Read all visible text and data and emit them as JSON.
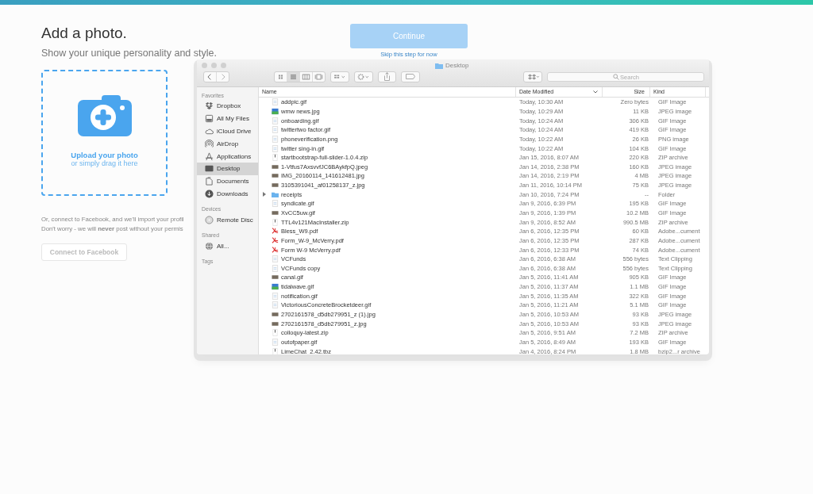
{
  "page": {
    "title": "Add a photo.",
    "subtitle": "Show your unique personality and style.",
    "continue_button": "Continue",
    "skip_link": "Skip this step for now",
    "upload": {
      "title": "Upload your photo",
      "hint": "or simply drag it here"
    },
    "facebook_text": "Or, connect to Facebook, and we'll import your profil\nDon't worry - we will **never** post without your permis",
    "facebook_button": "Connect to Facebook"
  },
  "finder": {
    "title": "Desktop",
    "search": {
      "placeholder": "Search"
    },
    "sidebar": [
      {
        "heading": "Favorites",
        "items": [
          {
            "label": "Dropbox",
            "kind": "dropbox",
            "selected": false
          },
          {
            "label": "All My Files",
            "kind": "files",
            "selected": false
          },
          {
            "label": "iCloud Drive",
            "kind": "cloud",
            "selected": false
          },
          {
            "label": "AirDrop",
            "kind": "airdrop",
            "selected": false
          },
          {
            "label": "Applications",
            "kind": "apps",
            "selected": false
          },
          {
            "label": "Desktop",
            "kind": "desktop",
            "selected": true
          },
          {
            "label": "Documents",
            "kind": "documents",
            "selected": false
          },
          {
            "label": "Downloads",
            "kind": "downloads",
            "selected": false
          }
        ]
      },
      {
        "heading": "Devices",
        "items": [
          {
            "label": "Remote Disc",
            "kind": "disc",
            "selected": false
          }
        ]
      },
      {
        "heading": "Shared",
        "items": [
          {
            "label": "All...",
            "kind": "globe",
            "selected": false
          }
        ]
      },
      {
        "heading": "Tags"
      }
    ],
    "columns": [
      "Name",
      "Date Modified",
      "Size",
      "Kind"
    ],
    "rows": [
      {
        "name": "addpic.gif",
        "date": "Today, 10:30 AM",
        "size": "Zero bytes",
        "kind_text": "GIF Image",
        "kind": "doc"
      },
      {
        "name": "wmw news.jpg",
        "date": "Today, 10:29 AM",
        "size": "11 KB",
        "kind_text": "JPEG image",
        "kind": "image"
      },
      {
        "name": "onboarding.gif",
        "date": "Today, 10:24 AM",
        "size": "306 KB",
        "kind_text": "GIF Image",
        "kind": "doc"
      },
      {
        "name": "twittertwo factor.gif",
        "date": "Today, 10:24 AM",
        "size": "419 KB",
        "kind_text": "GIF Image",
        "kind": "doc"
      },
      {
        "name": "phoneverification.png",
        "date": "Today, 10:22 AM",
        "size": "26 KB",
        "kind_text": "PNG image",
        "kind": "doc"
      },
      {
        "name": "twitter sing-in.gif",
        "date": "Today, 10:22 AM",
        "size": "104 KB",
        "kind_text": "GIF Image",
        "kind": "doc"
      },
      {
        "name": "startbootstrap-full-slider-1.0.4.zip",
        "date": "Jan 15, 2016, 8:07 AM",
        "size": "220 KB",
        "kind_text": "ZIP archive",
        "kind": "zip"
      },
      {
        "name": "1-Vtfus7AxsvvfJC6BAykfpQ.jpeg",
        "date": "Jan 14, 2016, 2:38 PM",
        "size": "160 KB",
        "kind_text": "JPEG image",
        "kind": "photo"
      },
      {
        "name": "IMG_20160114_141612481.jpg",
        "date": "Jan 14, 2016, 2:19 PM",
        "size": "4 MB",
        "kind_text": "JPEG image",
        "kind": "photo"
      },
      {
        "name": "3105391041_af01258137_z.jpg",
        "date": "Jan 11, 2016, 10:14 PM",
        "size": "75 KB",
        "kind_text": "JPEG image",
        "kind": "photo"
      },
      {
        "name": "receipts",
        "date": "Jan 10, 2016, 7:24 PM",
        "size": "--",
        "kind_text": "Folder",
        "kind": "folder",
        "expanded": false
      },
      {
        "name": "syndicate.gif",
        "date": "Jan 9, 2016, 6:39 PM",
        "size": "195 KB",
        "kind_text": "GIF Image",
        "kind": "doc"
      },
      {
        "name": "XvCC5uw.gif",
        "date": "Jan 9, 2016, 1:39 PM",
        "size": "10.2 MB",
        "kind_text": "GIF Image",
        "kind": "photo"
      },
      {
        "name": "TTL4v121MacInstaller.zip",
        "date": "Jan 9, 2016, 8:52 AM",
        "size": "990.5 MB",
        "kind_text": "ZIP archive",
        "kind": "zip"
      },
      {
        "name": "Bless_W9.pdf",
        "date": "Jan 6, 2016, 12:35 PM",
        "size": "60 KB",
        "kind_text": "Adobe...cument",
        "kind": "pdf"
      },
      {
        "name": "Form_W-9_McVerry.pdf",
        "date": "Jan 6, 2016, 12:35 PM",
        "size": "287 KB",
        "kind_text": "Adobe...cument",
        "kind": "pdf"
      },
      {
        "name": "Form W-9 McVerry.pdf",
        "date": "Jan 6, 2016, 12:33 PM",
        "size": "74 KB",
        "kind_text": "Adobe...cument",
        "kind": "pdf"
      },
      {
        "name": "VCFunds",
        "date": "Jan 6, 2016, 6:38 AM",
        "size": "556 bytes",
        "kind_text": "Text Clipping",
        "kind": "doc"
      },
      {
        "name": "VCFunds copy",
        "date": "Jan 6, 2016, 6:38 AM",
        "size": "556 bytes",
        "kind_text": "Text Clipping",
        "kind": "doc"
      },
      {
        "name": "canal.gif",
        "date": "Jan 5, 2016, 11:41 AM",
        "size": "905 KB",
        "kind_text": "GIF Image",
        "kind": "photo"
      },
      {
        "name": "tidalwave.gif",
        "date": "Jan 5, 2016, 11:37 AM",
        "size": "1.1 MB",
        "kind_text": "GIF Image",
        "kind": "image"
      },
      {
        "name": "notification.gif",
        "date": "Jan 5, 2016, 11:35 AM",
        "size": "322 KB",
        "kind_text": "GIF Image",
        "kind": "doc"
      },
      {
        "name": "VictoriousConcreteBrocketdeer.gif",
        "date": "Jan 5, 2016, 11:21 AM",
        "size": "5.1 MB",
        "kind_text": "GIF Image",
        "kind": "doc"
      },
      {
        "name": "2702161578_d5db279951_z (1).jpg",
        "date": "Jan 5, 2016, 10:53 AM",
        "size": "93 KB",
        "kind_text": "JPEG image",
        "kind": "photo"
      },
      {
        "name": "2702161578_d5db279951_z.jpg",
        "date": "Jan 5, 2016, 10:53 AM",
        "size": "93 KB",
        "kind_text": "JPEG image",
        "kind": "photo"
      },
      {
        "name": "colloquy-latest.zip",
        "date": "Jan 5, 2016, 9:51 AM",
        "size": "7.2 MB",
        "kind_text": "ZIP archive",
        "kind": "zip"
      },
      {
        "name": "outofpaper.gif",
        "date": "Jan 5, 2016, 8:49 AM",
        "size": "193 KB",
        "kind_text": "GIF Image",
        "kind": "doc"
      },
      {
        "name": "LimeChat_2.42.tbz",
        "date": "Jan 4, 2016, 8:24 PM",
        "size": "1.8 MB",
        "kind_text": "bzip2...r archive",
        "kind": "zip"
      }
    ]
  }
}
